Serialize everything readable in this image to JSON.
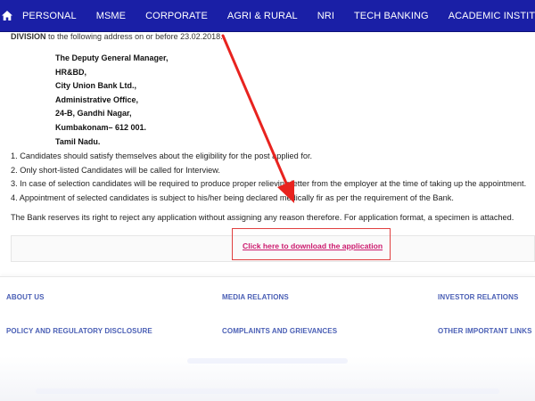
{
  "nav": {
    "items": [
      "PERSONAL",
      "MSME",
      "CORPORATE",
      "AGRI & RURAL",
      "NRI",
      "TECH BANKING",
      "ACADEMIC INSTITUTIONS"
    ],
    "color": "#1a1fa6"
  },
  "division_line": {
    "bold": "DIVISION",
    "rest": " to the following address on or before 23.02.2018."
  },
  "address": {
    "lines": [
      "The Deputy General Manager,",
      "HR&BD,",
      "City Union Bank Ltd.,",
      "Administrative Office,",
      "24-B, Gandhi Nagar,",
      "Kumbakonam– 612 001.",
      "Tamil Nadu."
    ]
  },
  "conditions": [
    "1. Candidates should satisfy themselves about the eligibility for the post applied for.",
    "2. Only short-listed Candidates will be called for Interview.",
    "3. In case of selection candidates will be required to produce proper relieving letter from the employer at the time of taking up the appointment.",
    "4. Appointment of selected candidates is subject to his/her being declared medically fir as per the requirement of the Bank."
  ],
  "reserve_text": "The Bank reserves its right to reject any application without assigning any reason therefore. For application format, a specimen is attached.",
  "download": {
    "label": "Click here to download the application",
    "color": "#cc1a6e",
    "highlight_color": "#e04040"
  },
  "footer": {
    "links": [
      "ABOUT US",
      "MEDIA RELATIONS",
      "INVESTOR RELATIONS",
      "POLICY AND REGULATORY DISCLOSURE",
      "COMPLAINTS AND GRIEVANCES",
      "OTHER IMPORTANT LINKS"
    ],
    "color": "#4a5fb5"
  },
  "icons": {
    "home": "home-icon",
    "arrow": "annotation-arrow-icon"
  }
}
